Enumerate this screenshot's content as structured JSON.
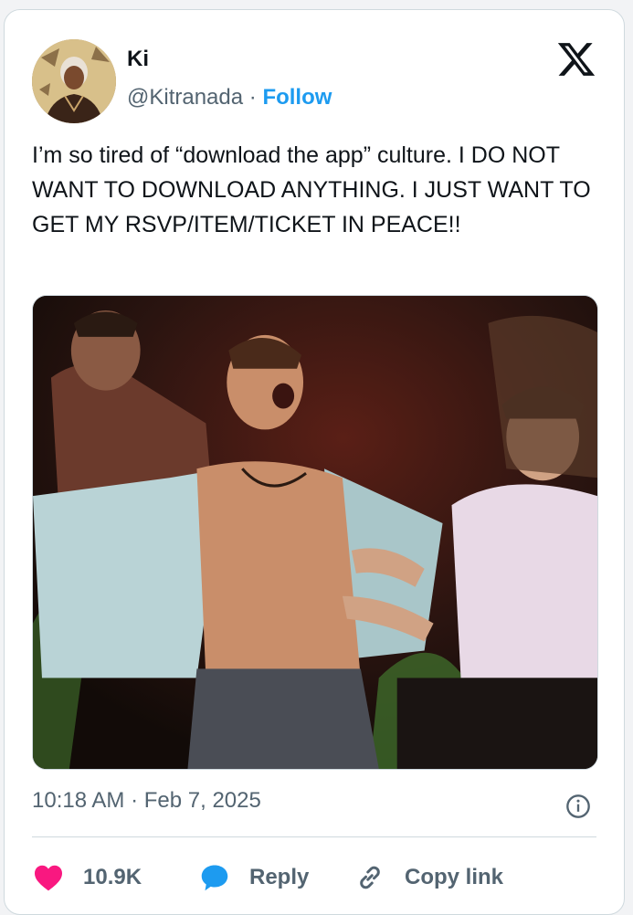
{
  "author": {
    "name": "Ki",
    "handle": "@Kitranada",
    "separator": " · ",
    "follow_label": "Follow"
  },
  "tweet": {
    "text": "I’m so tired of “download the app” culture. I DO NOT WANT TO DOWNLOAD ANYTHING. I JUST WANT TO GET MY RSVP/ITEM/TICKET IN PEACE!!",
    "timestamp": "10:18 AM · Feb 7, 2025"
  },
  "actions": {
    "like_count": "10.9K",
    "reply_label": "Reply",
    "copy_label": "Copy link"
  },
  "icons": {
    "brand": "x-logo-icon",
    "like": "heart-icon",
    "reply": "speech-bubble-icon",
    "copy": "link-icon",
    "info": "info-icon"
  },
  "colors": {
    "link": "#1d9bf0",
    "like": "#f91880",
    "muted": "#536471"
  }
}
